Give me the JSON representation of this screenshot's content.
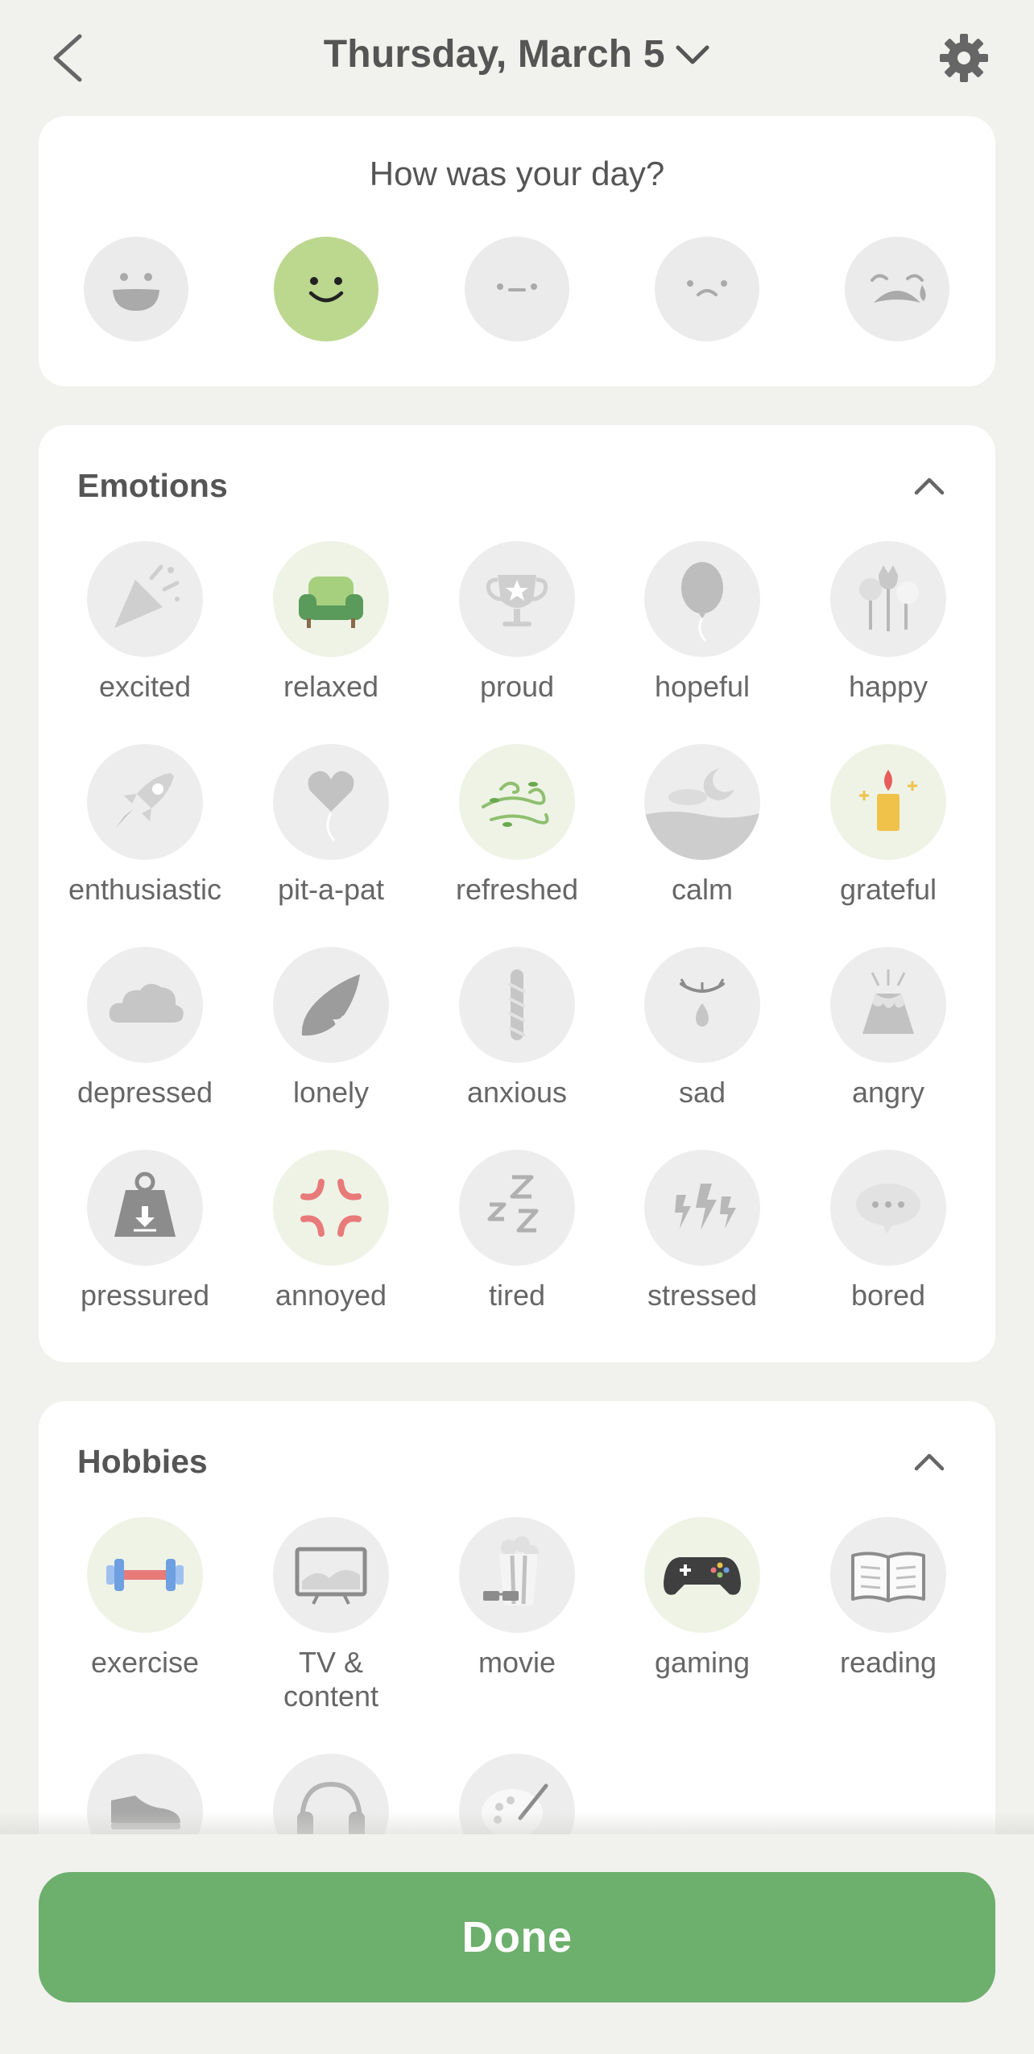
{
  "header": {
    "title": "Thursday, March 5"
  },
  "mood": {
    "question": "How was your day?",
    "faces": [
      {
        "icon": "grinning-face-icon",
        "selected": false
      },
      {
        "icon": "smiling-face-icon",
        "selected": true
      },
      {
        "icon": "neutral-face-icon",
        "selected": false
      },
      {
        "icon": "frowning-face-icon",
        "selected": false
      },
      {
        "icon": "crying-face-icon",
        "selected": false
      }
    ]
  },
  "emotions": {
    "title": "Emotions",
    "items": [
      {
        "label": "excited",
        "icon": "party-popper-icon",
        "selected": false
      },
      {
        "label": "relaxed",
        "icon": "armchair-icon",
        "selected": true
      },
      {
        "label": "proud",
        "icon": "trophy-icon",
        "selected": false
      },
      {
        "label": "hopeful",
        "icon": "balloon-icon",
        "selected": false
      },
      {
        "label": "happy",
        "icon": "flowers-icon",
        "selected": false
      },
      {
        "label": "enthusiastic",
        "icon": "rocket-icon",
        "selected": false
      },
      {
        "label": "pit-a-pat",
        "icon": "heart-balloon-icon",
        "selected": false
      },
      {
        "label": "refreshed",
        "icon": "wind-icon",
        "selected": true
      },
      {
        "label": "calm",
        "icon": "moon-water-icon",
        "selected": false
      },
      {
        "label": "grateful",
        "icon": "candle-icon",
        "selected": true
      },
      {
        "label": "depressed",
        "icon": "cloud-icon",
        "selected": false
      },
      {
        "label": "lonely",
        "icon": "leaf-icon",
        "selected": false
      },
      {
        "label": "anxious",
        "icon": "rope-icon",
        "selected": false
      },
      {
        "label": "sad",
        "icon": "teardrop-eye-icon",
        "selected": false
      },
      {
        "label": "angry",
        "icon": "volcano-icon",
        "selected": false
      },
      {
        "label": "pressured",
        "icon": "weight-icon",
        "selected": false
      },
      {
        "label": "annoyed",
        "icon": "anger-mark-icon",
        "selected": true
      },
      {
        "label": "tired",
        "icon": "zzz-icon",
        "selected": false
      },
      {
        "label": "stressed",
        "icon": "lightning-icon",
        "selected": false
      },
      {
        "label": "bored",
        "icon": "speech-bubble-icon",
        "selected": false
      }
    ]
  },
  "hobbies": {
    "title": "Hobbies",
    "items": [
      {
        "label": "exercise",
        "icon": "dumbbell-icon",
        "selected": true
      },
      {
        "label": "TV &\ncontent",
        "icon": "tv-icon",
        "selected": false
      },
      {
        "label": "movie",
        "icon": "popcorn-icon",
        "selected": false
      },
      {
        "label": "gaming",
        "icon": "gamepad-icon",
        "selected": true
      },
      {
        "label": "reading",
        "icon": "book-icon",
        "selected": false
      },
      {
        "label": "",
        "icon": "sneaker-icon",
        "selected": false
      },
      {
        "label": "",
        "icon": "headphones-icon",
        "selected": false
      },
      {
        "label": "",
        "icon": "palette-icon",
        "selected": false
      }
    ]
  },
  "footer": {
    "done_label": "Done"
  },
  "colors": {
    "accent": "#6daf6d",
    "mood_selected": "#bcd88f",
    "background": "#f1f1ed",
    "card": "#ffffff"
  }
}
